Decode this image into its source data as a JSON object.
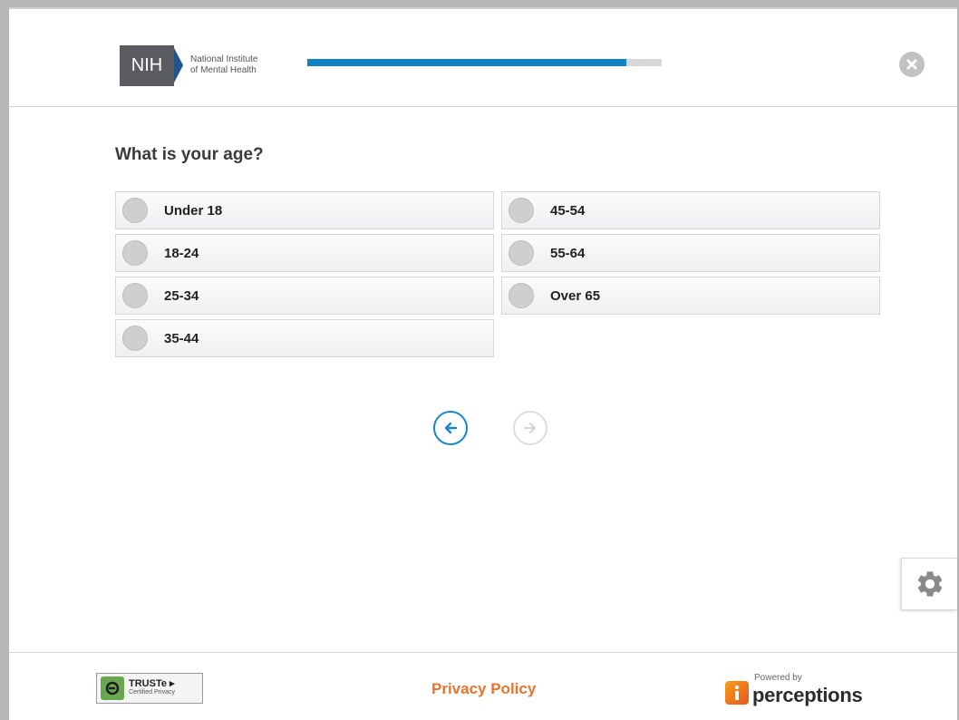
{
  "header": {
    "logo": {
      "abbrev": "NIH",
      "line1": "National Institute",
      "line2": "of Mental Health"
    },
    "progress_percent": 90
  },
  "question": {
    "text": "What is your age?",
    "options": [
      "Under 18",
      "18-24",
      "25-34",
      "35-44",
      "45-54",
      "55-64",
      "Over 65"
    ]
  },
  "icons": {
    "close": "close-icon",
    "back": "arrow-left-icon",
    "next": "arrow-right-icon",
    "settings": "gear-icon"
  },
  "footer": {
    "truste_name": "TRUSTe",
    "truste_sub": "Certified Privacy",
    "privacy_label": "Privacy Policy",
    "powered_by": "Powered by",
    "brand": "perceptions"
  },
  "colors": {
    "accent": "#0f83c4",
    "privacy_link": "#e8732c"
  }
}
